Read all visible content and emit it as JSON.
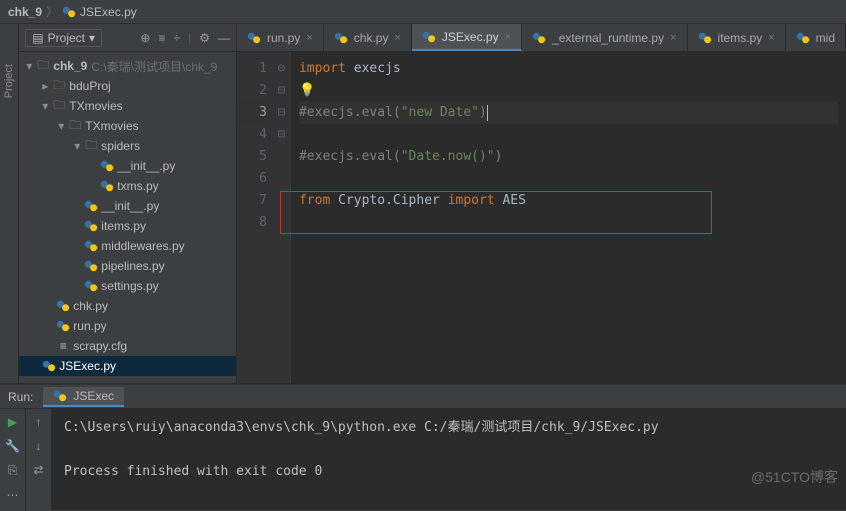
{
  "breadcrumb": {
    "root": "chk_9",
    "file": "JSExec.py"
  },
  "project": {
    "title": "Project",
    "root": {
      "name": "chk_9",
      "path": "C:\\秦瑞\\测试项目\\chk_9"
    },
    "tree": {
      "bduProj": "bduProj",
      "TXmovies": "TXmovies",
      "TXmovies_inner": "TXmovies",
      "spiders": "spiders",
      "spiders_init": "__init__.py",
      "txms": "txms.py",
      "init": "__init__.py",
      "items": "items.py",
      "middlewares": "middlewares.py",
      "pipelines": "pipelines.py",
      "settings": "settings.py",
      "chk": "chk.py",
      "run": "run.py",
      "scrapy_cfg": "scrapy.cfg",
      "jsexec": "JSExec.py"
    }
  },
  "tabs": {
    "run": "run.py",
    "chk": "chk.py",
    "jsexec": "JSExec.py",
    "external": "_external_runtime.py",
    "items": "items.py",
    "mid": "mid"
  },
  "code": {
    "l1_kw": "import",
    "l1_mod": " execjs",
    "l3": "#execjs.eval(",
    "l3_str": "\"new Date\"",
    "l3_end": ")",
    "l5": "#execjs.eval(",
    "l5_str": "\"Date.now()\"",
    "l5_end": ")",
    "l7_kw": "from",
    "l7_a": " Crypto.Cipher ",
    "l7_kw2": "import",
    "l7_b": " AES"
  },
  "line_numbers": [
    "1",
    "2",
    "3",
    "4",
    "5",
    "6",
    "7",
    "8"
  ],
  "run_panel": {
    "label": "Run:",
    "tab": "JSExec",
    "cmd": "C:\\Users\\ruiy\\anaconda3\\envs\\chk_9\\python.exe C:/秦瑞/测试项目/chk_9/JSExec.py",
    "result": "Process finished with exit code 0"
  },
  "sidebar_label": "Project",
  "watermark": "@51CTO博客"
}
